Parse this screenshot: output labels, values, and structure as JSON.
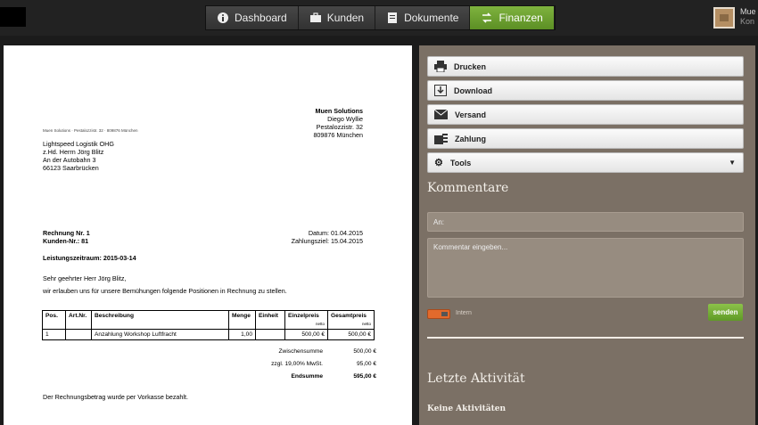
{
  "nav": {
    "items": [
      {
        "label": "Dashboard",
        "icon": "dashboard-icon"
      },
      {
        "label": "Kunden",
        "icon": "briefcase-icon"
      },
      {
        "label": "Dokumente",
        "icon": "document-icon"
      },
      {
        "label": "Finanzen",
        "icon": "transfer-icon",
        "active": true
      }
    ],
    "active_color": "#6aa12e"
  },
  "user": {
    "name": "Mue",
    "sub": "Kon"
  },
  "invoice": {
    "sender_line": "Muen Solutions · Pestalozzistr. 32 · 809876 München",
    "sender": {
      "company": "Muen Solutions",
      "name": "Diego Wyllie",
      "street": "Pestalozzistr. 32",
      "city": "809876 München"
    },
    "recipient": [
      "Lightspeed Logistik OHG",
      "z.Hd. Herrn Jörg Blitz",
      "An der Autobahn 3",
      "66123 Saarbrücken"
    ],
    "invoice_no": "Rechnung Nr. 1",
    "customer_no": "Kunden-Nr.: 81",
    "date": "Datum: 01.04.2015",
    "due": "Zahlungsziel: 15.04.2015",
    "period": "Leistungszeitraum: 2015-03-14",
    "salutation": "Sehr geehrter Herr Jörg Blitz,",
    "intro": "wir erlauben uns für unsere Bemühungen folgende Positionen in Rechnung zu stellen.",
    "table": {
      "headers": {
        "pos": "Pos.",
        "art": "Art.Nr.",
        "desc": "Beschreibung",
        "qty": "Menge",
        "unit": "Einheit",
        "price": "Einzelpreis",
        "total": "Gesamtpreis",
        "netto": "netto"
      },
      "rows": [
        {
          "pos": "1",
          "art": "",
          "desc": "Anzahlung Workshop Luftfracht",
          "qty": "1,00",
          "unit": "",
          "price": "500,00 €",
          "total": "500,00 €"
        }
      ]
    },
    "totals": [
      {
        "label": "Zwischensumme",
        "value": "500,00 €"
      },
      {
        "label": "zzgl. 19,00% MwSt.",
        "value": "95,00 €"
      },
      {
        "label": "Endsumme",
        "value": "595,00 €",
        "bold": true
      }
    ],
    "footer": "Der Rechnungsbetrag wurde per Vorkasse bezahlt."
  },
  "actions": {
    "print": "Drucken",
    "download": "Download",
    "send": "Versand",
    "payment": "Zahlung",
    "tools": "Tools"
  },
  "comments": {
    "title": "Kommentare",
    "to_placeholder": "An:",
    "body_placeholder": "Kommentar eingeben...",
    "intern_label": "Intern",
    "send_label": "senden"
  },
  "activity": {
    "title": "Letzte Aktivität",
    "empty": "Keine Aktivitäten"
  }
}
